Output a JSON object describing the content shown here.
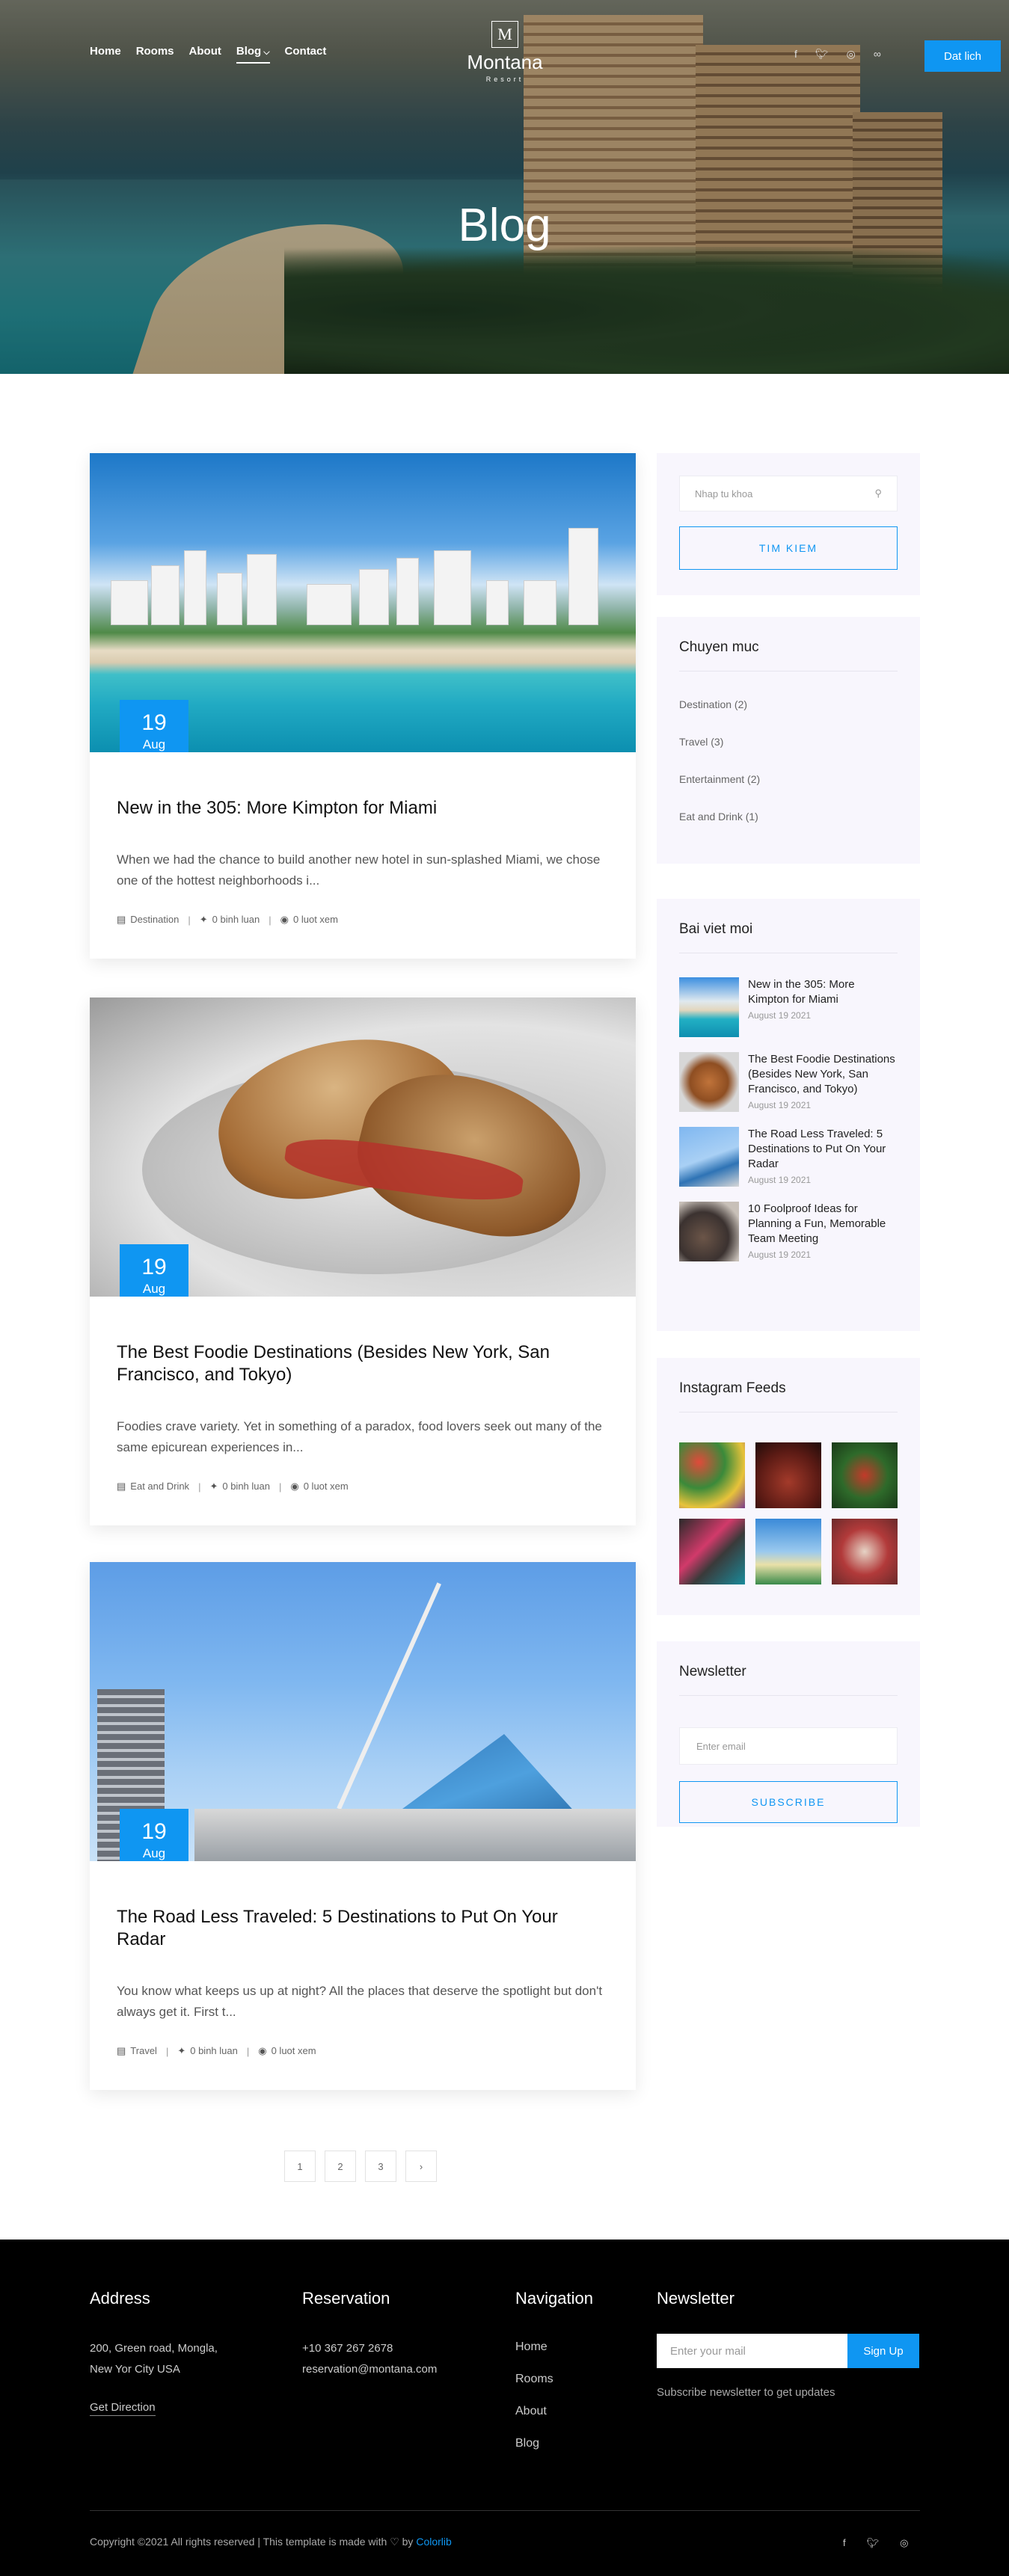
{
  "header": {
    "nav": [
      "Home",
      "Rooms",
      "About",
      "Blog",
      "Contact"
    ],
    "logo": {
      "letter": "M",
      "name": "Montana",
      "sub": "Resort"
    },
    "book_label": "Dat lich",
    "title": "Blog"
  },
  "posts": [
    {
      "day": "19",
      "month": "Aug",
      "title": "New in the 305: More Kimpton for Miami",
      "excerpt": "When we had the chance to build another new hotel in sun-splashed Miami, we chose one of the hottest neighborhoods i...",
      "category": "Destination",
      "comments": "0 binh luan",
      "views": "0 luot xem"
    },
    {
      "day": "19",
      "month": "Aug",
      "title": "The Best Foodie Destinations (Besides New York, San Francisco, and Tokyo)",
      "excerpt": "Foodies crave variety. Yet in something of a paradox, food lovers seek out many of the same epicurean experiences in...",
      "category": "Eat and Drink",
      "comments": "0 binh luan",
      "views": "0 luot xem"
    },
    {
      "day": "19",
      "month": "Aug",
      "title": "The Road Less Traveled: 5 Destinations to Put On Your Radar",
      "excerpt": "You know what keeps us up at night? All the places that deserve the spotlight but don't always get it. First t...",
      "category": "Travel",
      "comments": "0 binh luan",
      "views": "0 luot xem"
    }
  ],
  "pagination": [
    "1",
    "2",
    "3",
    "›"
  ],
  "sidebar": {
    "search_placeholder": "Nhap tu khoa",
    "search_button": "TIM KIEM",
    "categories_title": "Chuyen muc",
    "categories": [
      "Destination (2)",
      "Travel (3)",
      "Entertainment (2)",
      "Eat and Drink (1)"
    ],
    "recent_title": "Bai viet moi",
    "recent": [
      {
        "title": "New in the 305: More Kimpton for Miami",
        "date": "August 19 2021"
      },
      {
        "title": "The Best Foodie Destinations (Besides New York, San Francisco, and Tokyo)",
        "date": "August 19 2021"
      },
      {
        "title": "The Road Less Traveled: 5 Destinations to Put On Your Radar",
        "date": "August 19 2021"
      },
      {
        "title": "10 Foolproof Ideas for Planning a Fun, Memorable Team Meeting",
        "date": "August 19 2021"
      }
    ],
    "instagram_title": "Instagram Feeds",
    "newsletter_title": "Newsletter",
    "newsletter_placeholder": "Enter email",
    "newsletter_button": "SUBSCRIBE"
  },
  "footer": {
    "address_title": "Address",
    "address_lines": [
      "200, Green road, Mongla,",
      "New Yor City USA"
    ],
    "get_direction": "Get Direction",
    "reservation_title": "Reservation",
    "reservation_lines": [
      "+10 367 267 2678",
      "reservation@montana.com"
    ],
    "navigation_title": "Navigation",
    "navigation": [
      "Home",
      "Rooms",
      "About",
      "Blog"
    ],
    "newsletter_title": "Newsletter",
    "newsletter_placeholder": "Enter your mail",
    "newsletter_button": "Sign Up",
    "newsletter_sub": "Subscribe newsletter to get updates",
    "copyright": "Copyright ©2021 All rights reserved | This template is made with ♡ by ",
    "brand": "Colorlib"
  },
  "colors": {
    "accent": "#0f96f2",
    "footer_bg": "#000000",
    "sidebar_bg": "#f8f6fd"
  }
}
